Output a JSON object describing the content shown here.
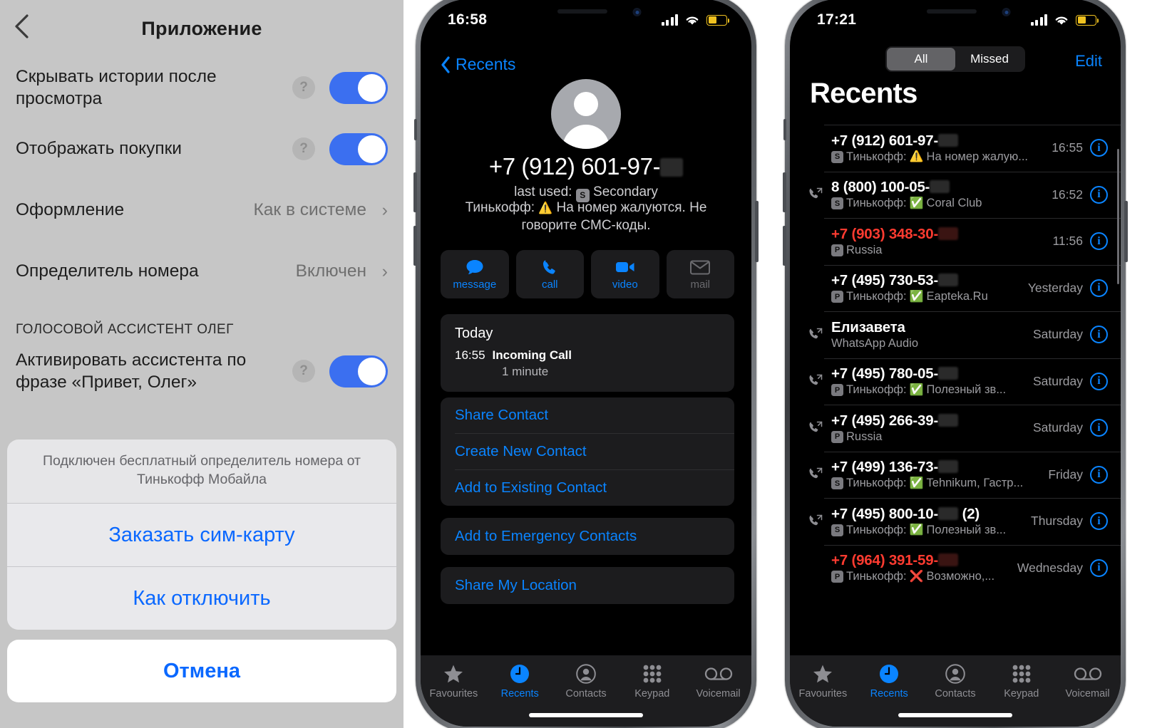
{
  "left_panel": {
    "header": {
      "back_icon": "chevron-left-icon",
      "title": "Приложение"
    },
    "rows": [
      {
        "label": "Скрывать истории после просмотра",
        "help": "?",
        "control": "toggle",
        "on": true
      },
      {
        "label": "Отображать покупки",
        "help": "?",
        "control": "toggle",
        "on": true
      },
      {
        "label": "Оформление",
        "value": "Как в системе",
        "control": "chevron",
        "chevron": "›"
      },
      {
        "label": "Определитель номера",
        "value": "Включен",
        "control": "chevron",
        "chevron": "›"
      }
    ],
    "section_title": "ГОЛОСОВОЙ АССИСТЕНТ ОЛЕГ",
    "assistant_row": {
      "label": "Активировать ассистента по фразе «Привет, Олег»",
      "help": "?",
      "on": true
    },
    "sheet": {
      "message": "Подключен бесплатный определитель номера от Тинькофф Мобайла",
      "actions": [
        "Заказать сим-карту",
        "Как отключить"
      ],
      "cancel": "Отмена"
    }
  },
  "mid_phone": {
    "status": {
      "time": "16:58",
      "cellular": "cellular-icon",
      "wifi": "wifi-icon",
      "battery": "battery-low-power-icon",
      "battery_color": "#f0c220"
    },
    "nav_back": {
      "icon": "chevron-left-icon",
      "label": "Recents"
    },
    "avatar": "default-contact-avatar",
    "number": "+7 (912) 601-97-",
    "last_used_prefix": "last used:",
    "sim_badge": "S",
    "last_used_label": "Secondary",
    "warning_prefix": "Тинькофф:",
    "warning_emoji": "⚠️",
    "warning_text": "На номер жалуются. Не говорите СМС-коды.",
    "actions": [
      {
        "label": "message",
        "icon": "message-bubble-icon",
        "disabled": false
      },
      {
        "label": "call",
        "icon": "phone-icon",
        "disabled": false
      },
      {
        "label": "video",
        "icon": "video-camera-icon",
        "disabled": false
      },
      {
        "label": "mail",
        "icon": "envelope-icon",
        "disabled": true
      }
    ],
    "today_card": {
      "title": "Today",
      "time": "16:55",
      "type": "Incoming Call",
      "duration": "1 minute"
    },
    "menu_items": [
      "Share Contact",
      "Create New Contact",
      "Add to Existing Contact"
    ],
    "emergency_item": "Add to Emergency Contacts",
    "location_item": "Share My Location",
    "tabs": [
      {
        "label": "Favourites",
        "icon": "star-icon",
        "active": false
      },
      {
        "label": "Recents",
        "icon": "clock-icon",
        "active": true
      },
      {
        "label": "Contacts",
        "icon": "person-circle-icon",
        "active": false
      },
      {
        "label": "Keypad",
        "icon": "keypad-grid-icon",
        "active": false
      },
      {
        "label": "Voicemail",
        "icon": "voicemail-icon",
        "active": false
      }
    ]
  },
  "right_phone": {
    "status": {
      "time": "17:21",
      "cellular": "cellular-icon",
      "wifi": "wifi-icon",
      "battery": "battery-low-power-icon",
      "battery_color": "#f0c220"
    },
    "segments": [
      {
        "label": "All",
        "selected": true
      },
      {
        "label": "Missed",
        "selected": false
      }
    ],
    "edit_label": "Edit",
    "title": "Recents",
    "rows": [
      {
        "icon": "",
        "name": "+7 (912) 601-97-",
        "redact": true,
        "missed": false,
        "sim": "S",
        "carrier": "Тинькофф:",
        "emoji": "⚠️",
        "detail": "На номер жалую...",
        "time": "16:55",
        "info": "i"
      },
      {
        "icon": "outgoing-call-icon",
        "name": "8 (800) 100-05-",
        "redact": true,
        "missed": false,
        "sim": "S",
        "carrier": "Тинькофф:",
        "emoji": "✅",
        "detail": "Coral Club",
        "time": "16:52",
        "info": "i"
      },
      {
        "icon": "",
        "name": "+7 (903) 348-30-",
        "redact": true,
        "missed": true,
        "sim": "P",
        "carrier": "",
        "emoji": "",
        "detail": "Russia",
        "time": "11:56",
        "info": "i"
      },
      {
        "icon": "",
        "name": "+7 (495) 730-53-",
        "redact": true,
        "missed": false,
        "sim": "P",
        "carrier": "Тинькофф:",
        "emoji": "✅",
        "detail": "Eapteka.Ru",
        "time": "Yesterday",
        "info": "i"
      },
      {
        "icon": "outgoing-call-icon",
        "name": "Елизавета",
        "redact": false,
        "missed": false,
        "sim": "",
        "carrier": "",
        "emoji": "",
        "detail": "WhatsApp Audio",
        "time": "Saturday",
        "info": "i"
      },
      {
        "icon": "outgoing-call-icon",
        "name": "+7 (495) 780-05-",
        "redact": true,
        "missed": false,
        "sim": "P",
        "carrier": "Тинькофф:",
        "emoji": "✅",
        "detail": "Полезный зв...",
        "time": "Saturday",
        "info": "i"
      },
      {
        "icon": "outgoing-call-icon",
        "name": "+7 (495) 266-39-",
        "redact": true,
        "missed": false,
        "sim": "P",
        "carrier": "",
        "emoji": "",
        "detail": "Russia",
        "time": "Saturday",
        "info": "i"
      },
      {
        "icon": "outgoing-call-icon",
        "name": "+7 (499) 136-73-",
        "redact": true,
        "missed": false,
        "sim": "S",
        "carrier": "Тинькофф:",
        "emoji": "✅",
        "detail": "Tehnikum, Гастр...",
        "time": "Friday",
        "info": "i"
      },
      {
        "icon": "outgoing-call-icon",
        "name": "+7 (495) 800-10-",
        "redact": true,
        "suffix": "(2)",
        "missed": false,
        "sim": "S",
        "carrier": "Тинькофф:",
        "emoji": "✅",
        "detail": "Полезный зв...",
        "time": "Thursday",
        "info": "i"
      },
      {
        "icon": "",
        "name": "+7 (964) 391-59-",
        "redact": true,
        "missed": true,
        "sim": "P",
        "carrier": "Тинькофф:",
        "emoji": "❌",
        "detail": "Возможно,...",
        "time": "Wednesday",
        "info": "i"
      }
    ],
    "tabs": [
      {
        "label": "Favourites",
        "icon": "star-icon",
        "active": false
      },
      {
        "label": "Recents",
        "icon": "clock-icon",
        "active": true
      },
      {
        "label": "Contacts",
        "icon": "person-circle-icon",
        "active": false
      },
      {
        "label": "Keypad",
        "icon": "keypad-grid-icon",
        "active": false
      },
      {
        "label": "Voicemail",
        "icon": "voicemail-icon",
        "active": false
      }
    ]
  }
}
